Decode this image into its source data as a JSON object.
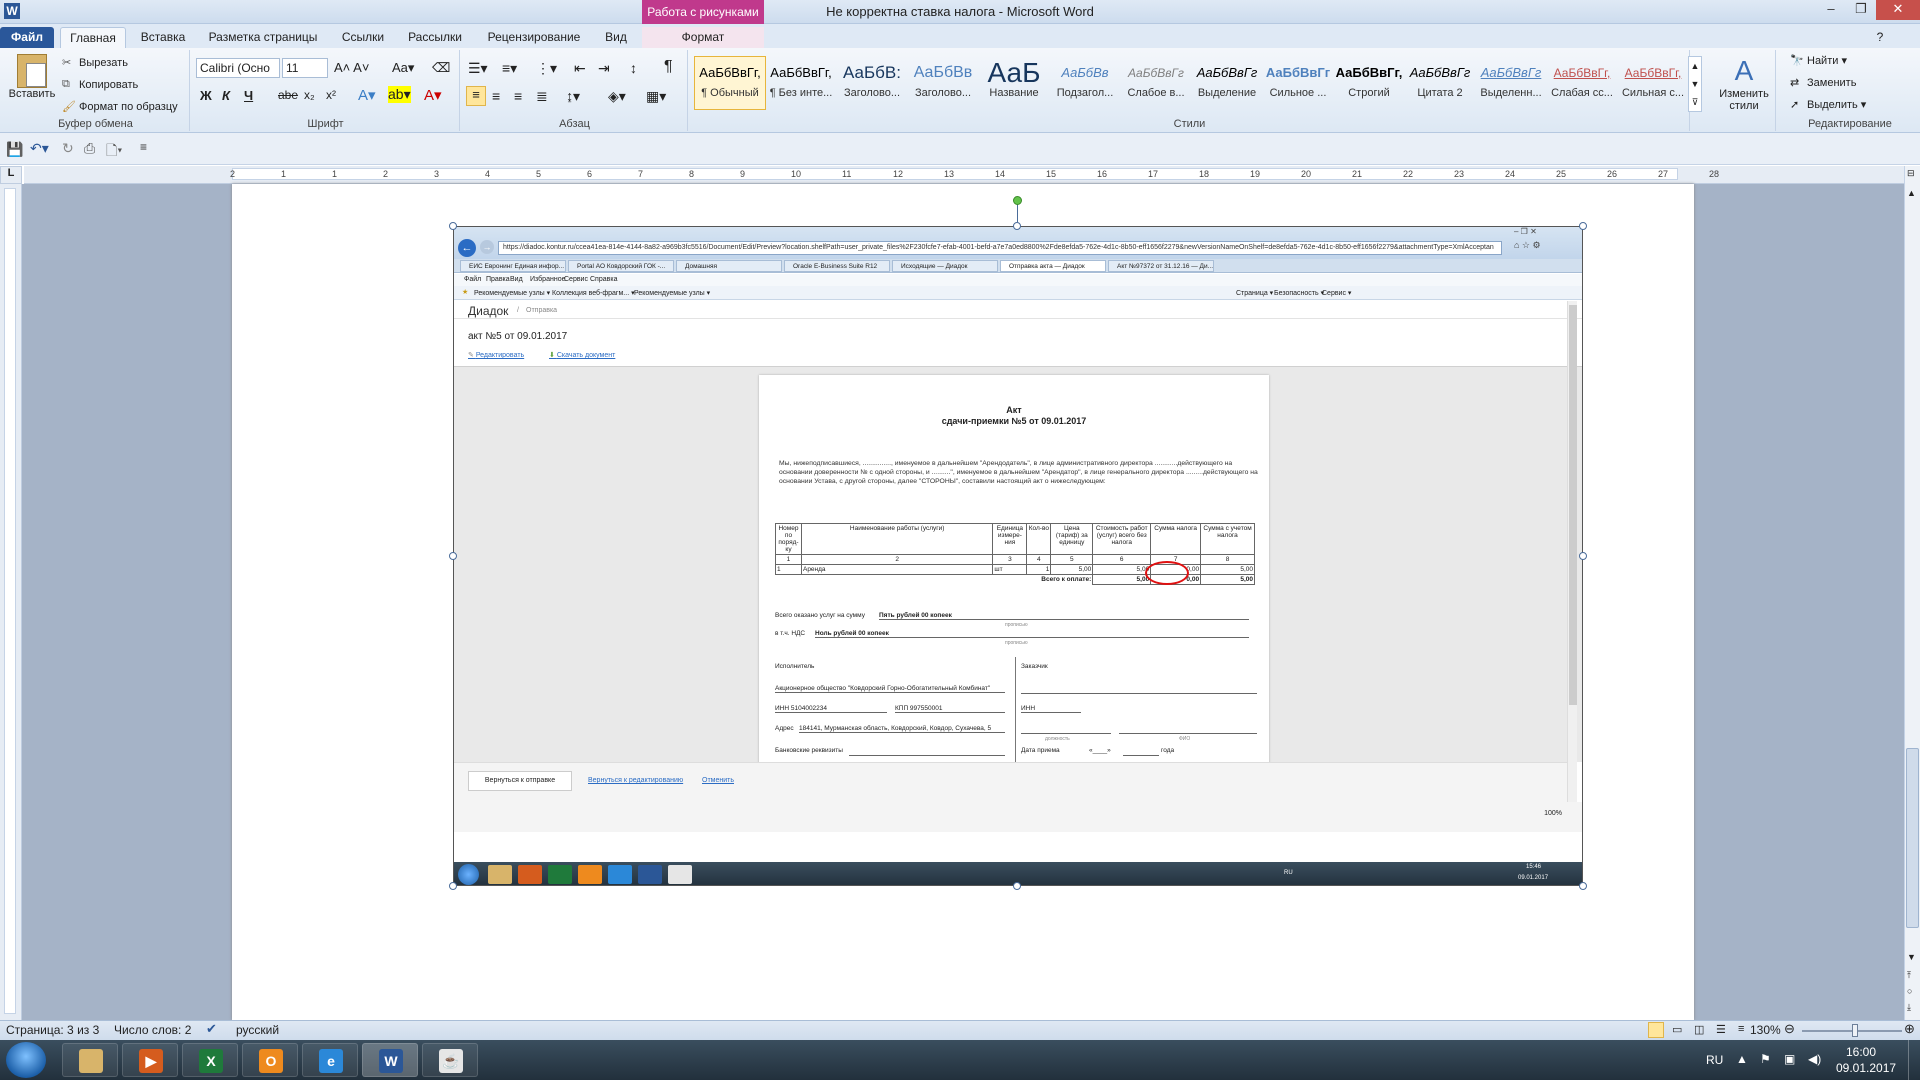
{
  "window": {
    "title": "Не корректна ставка налога - Microsoft Word",
    "context_tab_group": "Работа с рисунками",
    "app_icon": "W"
  },
  "tabs": [
    "Файл",
    "Главная",
    "Вставка",
    "Разметка страницы",
    "Ссылки",
    "Рассылки",
    "Рецензирование",
    "Вид",
    "Формат"
  ],
  "ribbon": {
    "clipboard": {
      "paste": "Вставить",
      "cut": "Вырезать",
      "copy": "Копировать",
      "format_painter": "Формат по образцу",
      "label": "Буфер обмена"
    },
    "font": {
      "name": "Calibri (Осно",
      "size": "11",
      "label": "Шрифт",
      "bold": "Ж",
      "italic": "К",
      "underline": "Ч",
      "strike": "abe"
    },
    "paragraph": {
      "label": "Абзац"
    },
    "styles": {
      "label": "Стили",
      "items": [
        {
          "sample": "АаБбВвГг,",
          "name": "¶ Обычный"
        },
        {
          "sample": "АаБбВвГг,",
          "name": "¶ Без инте..."
        },
        {
          "sample": "АаБбВ:",
          "name": "Заголово..."
        },
        {
          "sample": "АаБбВв",
          "name": "Заголово..."
        },
        {
          "sample": "АаБ",
          "name": "Название"
        },
        {
          "sample": "АаБбВв",
          "name": "Подзагол..."
        },
        {
          "sample": "АаБбВвГг",
          "name": "Слабое в..."
        },
        {
          "sample": "АаБбВвГг",
          "name": "Выделение"
        },
        {
          "sample": "АаБбВвГг",
          "name": "Сильное ..."
        },
        {
          "sample": "АаБбВвГг,",
          "name": "Строгий"
        },
        {
          "sample": "АаБбВвГг",
          "name": "Цитата 2"
        },
        {
          "sample": "АаБбВвГг",
          "name": "Выделенн..."
        },
        {
          "sample": "АаБбВвГг,",
          "name": "Слабая сс..."
        },
        {
          "sample": "АаБбВвГг,",
          "name": "Сильная с..."
        }
      ],
      "change_styles": "Изменить стили"
    },
    "editing": {
      "find": "Найти",
      "replace": "Заменить",
      "select": "Выделить",
      "label": "Редактирование"
    }
  },
  "ruler": {
    "marks": [
      "2",
      "1",
      "1",
      "2",
      "3",
      "4",
      "5",
      "6",
      "7",
      "8",
      "9",
      "10",
      "11",
      "12",
      "13",
      "14",
      "15",
      "16",
      "17",
      "18",
      "19",
      "20",
      "21",
      "22",
      "23",
      "24",
      "25",
      "26",
      "27",
      "28"
    ]
  },
  "status": {
    "page": "Страница: 3 из 3",
    "words": "Число слов: 2",
    "lang": "русский",
    "zoom": "130%"
  },
  "taskbar": {
    "lang": "RU",
    "time": "16:00",
    "date": "09.01.2017"
  },
  "embedded": {
    "url": "https://diadoc.kontur.ru/ccea41ea-814e-4144-8a82-a969b3fc5516/Document/Edit/Preview?location.shelfPath=user_private_files%2F230fcfe7-efab-4001-befd-a7e7a0ed8800%2Fde8efda5-762e-4d1c-8b50-eff1656f2279&newVersionNameOnShelf=de8efda5-762e-4d1c-8b50-eff1656f2279&attachmentType=XmlAcceptan",
    "ie_tabs": [
      "ЕИС Евронинг Единая инфор...",
      "Portal АО Ковдорский ГОК -...",
      "Домашняя",
      "Oracle E-Business Suite R12",
      "Исходящие — Диадок",
      "Отправка акта — Диадок",
      "Акт №97372 от 31.12.16 — Ди..."
    ],
    "menu": [
      "Файл",
      "Правка",
      "Вид",
      "Избранное",
      "Сервис",
      "Справка"
    ],
    "favbar": [
      "Рекомендуемые узлы ▾",
      "Коллекция веб-фрагм... ▾",
      "Рекомендуемые узлы ▾"
    ],
    "cmdbar": [
      "Страница ▾",
      "Безопасность ▾",
      "Сервис ▾"
    ],
    "app": "Диадок",
    "crumb": "Отправка",
    "doc_title": "акт №5 от 09.01.2017",
    "edit_link": "Редактировать",
    "download_link": "Скачать документ",
    "act_title": "Акт",
    "act_subtitle": "сдачи-приемки №5 от 09.01.2017",
    "intro": "Мы, нижеподписавшиеся, ..............., именуемое в дальнейшем \"Арендодатель\", в лице административного директора ............действующего на основании доверенности № с одной стороны, и ..........\", именуемое в дальнейшем \"Арендатор\", в лице генерального директора .........действующего на основании Устава, с другой стороны, далее \"СТОРОНЫ\", составили настоящий акт о нижеследующем:",
    "table_headers": [
      "Номер по поряд-ку",
      "Наименование работы (услуги)",
      "Единица измере-ния",
      "Кол-во",
      "Цена (тариф) за единицу",
      "Стоимость работ (услуг) всего без налога",
      "Сумма налога",
      "Сумма с учетом налога"
    ],
    "table_nums": [
      "1",
      "2",
      "3",
      "4",
      "5",
      "6",
      "7",
      "8"
    ],
    "row": [
      "1",
      "Аренда",
      "шт",
      "1",
      "5,00",
      "5,00",
      "0,00",
      "5,00"
    ],
    "total_label": "Всего к оплате:",
    "total": [
      "5,00",
      "0,00",
      "5,00"
    ],
    "sum_label": "Всего оказано услуг на сумму",
    "sum_words": "Пять рублей 00 копеек",
    "words_caption": "прописью",
    "vat_label": "в т.ч. НДС",
    "vat_words": "Ноль рублей 00 копеек",
    "executor": "Исполнитель",
    "customer": "Заказчик",
    "company": "Акционерное общество \"Ковдорский Горно-Обогатительный Комбинат\"",
    "inn": "ИНН  5104002234",
    "kpp": "КПП  997550001",
    "inn_c": "ИНН",
    "address_label": "Адрес",
    "address": "184141, Мурманская область, Ковдорский, Ковдор, Сухачева, 5",
    "bank": "Банковские реквизиты",
    "position": "должность",
    "fio": "ФИО",
    "accept_date": "Дата приема",
    "accept_quote": "«____»",
    "accept_year": "года",
    "btn_back": "Вернуться к отправке",
    "link_edit": "Вернуться к редактированию",
    "link_cancel": "Отменить",
    "zoom": "100%",
    "tray_lang": "RU",
    "tray_time": "15:46",
    "tray_date": "09.01.2017"
  }
}
